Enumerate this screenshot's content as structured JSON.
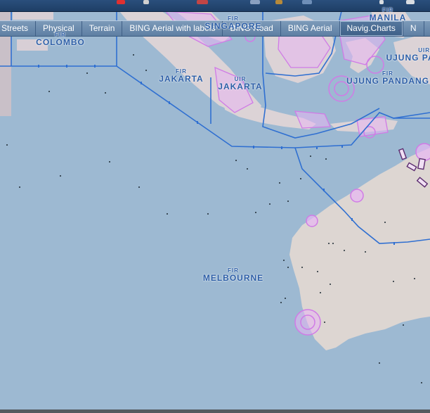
{
  "layer_tabs": [
    {
      "label": "l Streets",
      "active": false
    },
    {
      "label": "Physical",
      "active": false
    },
    {
      "label": "Terrain",
      "active": false
    },
    {
      "label": "BING Aerial with labels",
      "active": false
    },
    {
      "label": "BING Road",
      "active": false
    },
    {
      "label": "BING Aerial",
      "active": false
    },
    {
      "label": "Navig.Charts",
      "active": true
    },
    {
      "label": "N",
      "active": false
    }
  ],
  "regions": {
    "colombo": {
      "kind": "FIR",
      "name": "COLOMBO"
    },
    "singapore": {
      "kind": "FIR",
      "name": "SINGAPORE"
    },
    "jakarta_fir": {
      "kind": "FIR",
      "name": "JAKARTA"
    },
    "jakarta_uir": {
      "kind": "UIR",
      "name": "JAKARTA"
    },
    "manila": {
      "kind": "FIR",
      "name": "MANILA"
    },
    "ujung_uir": {
      "kind": "UIR",
      "name": "UJUNG PA"
    },
    "ujung_fir": {
      "kind": "FIR",
      "name": "UJUNG PANDANG"
    },
    "melbourne": {
      "kind": "FIR",
      "name": "MELBOURNE"
    }
  },
  "colors": {
    "ocean": "#9db9d2",
    "land": "#ddd6d2",
    "fir_boundary": "#2f6fd1",
    "airspace": "#e7b6f2",
    "label": "#2b5da6"
  }
}
